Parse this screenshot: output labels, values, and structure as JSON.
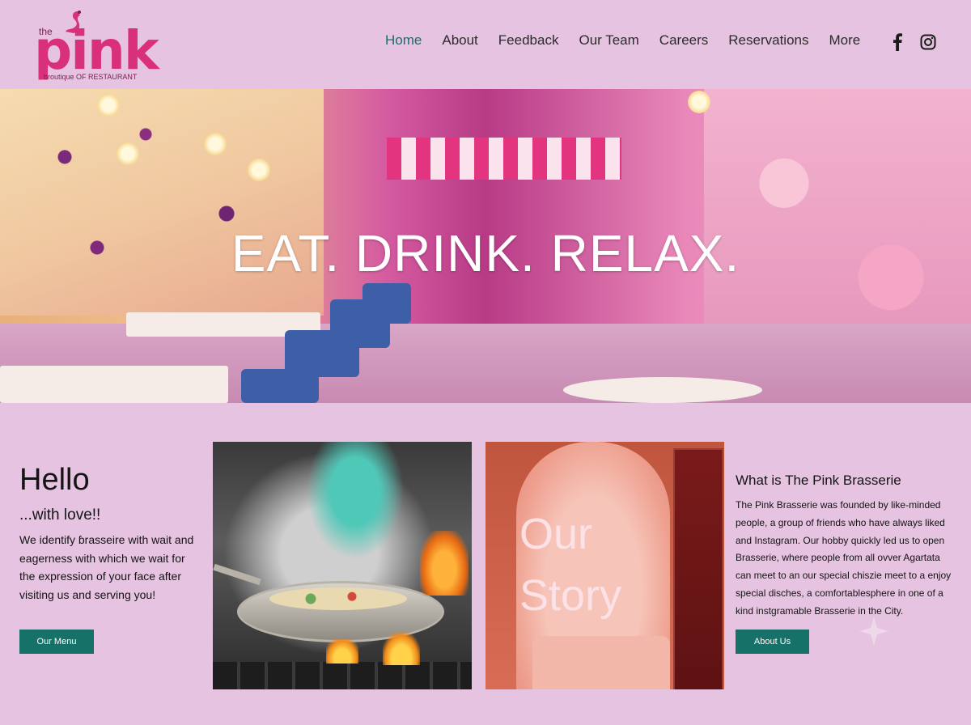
{
  "logo": {
    "the": "the",
    "word": "pink",
    "tagline": "broutique OF RESTAURANT"
  },
  "nav": {
    "items": [
      "Home",
      "About",
      "Feedback",
      "Our Team",
      "Careers",
      "Reservations",
      "More"
    ],
    "active": "Home"
  },
  "social": [
    "facebook-icon",
    "instagram-icon"
  ],
  "hero": {
    "title": "EAT. DRINK. RELAX."
  },
  "intro": {
    "heading": "Hello",
    "subheading": "...with love!!",
    "body": "We identify ɓrasseire with wait and eagerness with which we wait for the expression of your face after visiting us and serving you!",
    "button": "Our Menu"
  },
  "story_image": {
    "text_line1": "Our",
    "text_line2": "Story"
  },
  "about": {
    "title": "What is The Pink Brasserie",
    "body": "The Pink Brasserie was founded by like-minded people, a group of friends who have always liked and Instagram. Our hobby quickly led us to open Brasserie, where people from all ovver Agartata can meet to an our special chiszie meet to a enjoy special disches, a comfortablesphere in one of a kind instgramable Brasserie in the City.",
    "button": "About Us"
  },
  "colors": {
    "page_bg": "#e6c3e0",
    "accent_button": "#167168",
    "active_nav": "#1f6b6b",
    "logo_pink": "#d8317a"
  }
}
